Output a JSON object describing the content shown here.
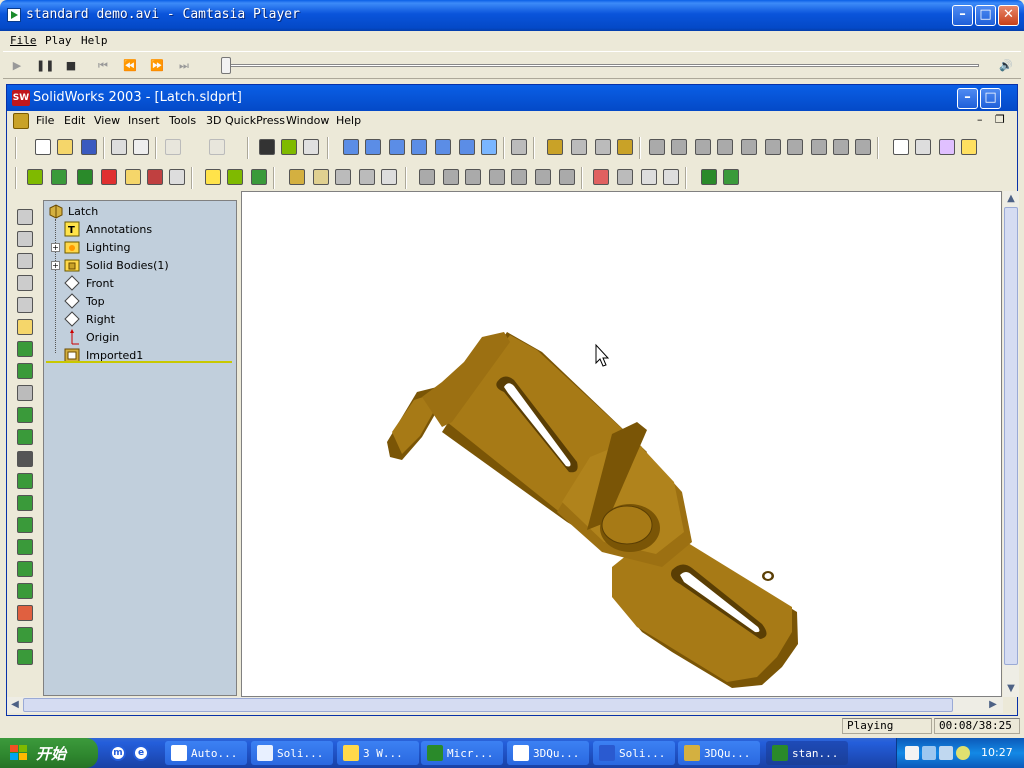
{
  "player": {
    "title": "standard demo.avi - Camtasia Player",
    "menu": [
      "File",
      "Play",
      "Help"
    ],
    "status": "Playing",
    "time": "00:08/38:25",
    "seek_fraction": 0.0
  },
  "sw": {
    "title": "SolidWorks 2003 - [Latch.sldprt]",
    "logo": "SW",
    "menu": [
      "File",
      "Edit",
      "View",
      "Insert",
      "Tools",
      "3D QuickPress",
      "Window",
      "Help"
    ],
    "tree": {
      "root": "Latch",
      "items": [
        {
          "label": "Annotations",
          "expandable": false
        },
        {
          "label": "Lighting",
          "expandable": true
        },
        {
          "label": "Solid Bodies(1)",
          "expandable": true
        },
        {
          "label": "Front",
          "expandable": false
        },
        {
          "label": "Top",
          "expandable": false
        },
        {
          "label": "Right",
          "expandable": false
        },
        {
          "label": "Origin",
          "expandable": false
        },
        {
          "label": "Imported1",
          "expandable": false
        }
      ]
    }
  },
  "taskbar": {
    "start_label": "开始",
    "tasks": [
      "Auto...",
      "Soli...",
      "3 W...",
      "Micr...",
      "3DQu...",
      "Soli...",
      "3DQu...",
      "stan..."
    ],
    "clock": "10:27"
  },
  "colors": {
    "part": "#A77A16",
    "part_dark": "#7A5506",
    "tree_bg": "#C1CFDC",
    "xp_blue": "#0A54DB"
  }
}
